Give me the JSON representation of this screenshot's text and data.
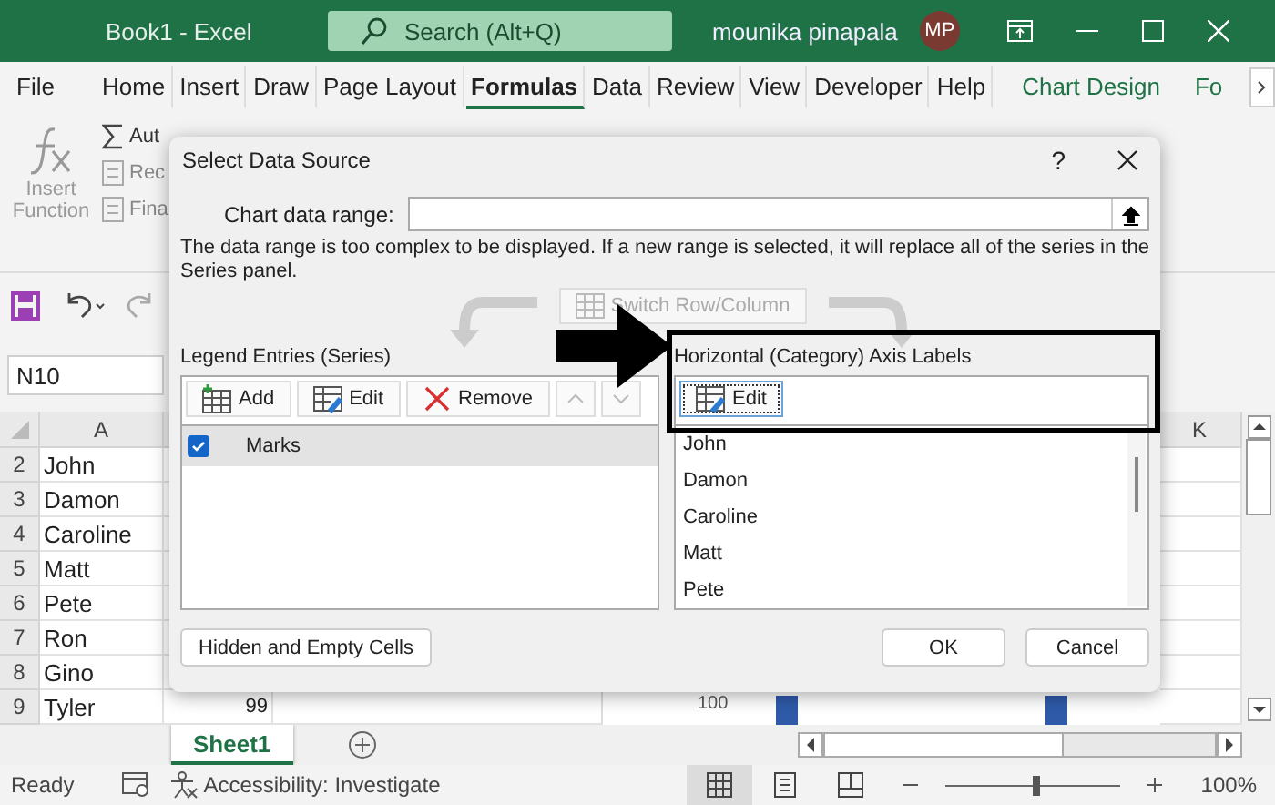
{
  "window": {
    "title": "Book1 - Excel",
    "search_placeholder": "Search (Alt+Q)",
    "user": "mounika pinapala",
    "avatar": "MP"
  },
  "ribbon_tabs": [
    {
      "label": "File",
      "selected": false,
      "kind": "plain"
    },
    {
      "label": "Home",
      "selected": false,
      "kind": "plain"
    },
    {
      "label": "Insert",
      "selected": false,
      "kind": "plain"
    },
    {
      "label": "Draw",
      "selected": false,
      "kind": "plain"
    },
    {
      "label": "Page Layout",
      "selected": false,
      "kind": "plain"
    },
    {
      "label": "Formulas",
      "selected": true,
      "kind": "plain"
    },
    {
      "label": "Data",
      "selected": false,
      "kind": "plain"
    },
    {
      "label": "Review",
      "selected": false,
      "kind": "plain"
    },
    {
      "label": "View",
      "selected": false,
      "kind": "plain"
    },
    {
      "label": "Developer",
      "selected": false,
      "kind": "plain"
    },
    {
      "label": "Help",
      "selected": false,
      "kind": "plain"
    },
    {
      "label": "Chart Design",
      "selected": false,
      "kind": "context"
    },
    {
      "label": "Fo",
      "selected": false,
      "kind": "context"
    }
  ],
  "ribbon": {
    "insert_function": "Insert Function",
    "commands": [
      "Aut",
      "Rec",
      "Fina"
    ]
  },
  "name_box": "N10",
  "grid": {
    "column_headers": [
      "A",
      "K"
    ],
    "rows": [
      {
        "number": "2",
        "name": "John"
      },
      {
        "number": "3",
        "name": "Damon"
      },
      {
        "number": "4",
        "name": "Caroline"
      },
      {
        "number": "5",
        "name": "Matt"
      },
      {
        "number": "6",
        "name": "Pete"
      },
      {
        "number": "7",
        "name": "Ron"
      },
      {
        "number": "8",
        "name": "Gino"
      },
      {
        "number": "9",
        "name": "Tyler",
        "value": "99"
      }
    ]
  },
  "chart_axis_label": "100",
  "sheet_tabs": [
    {
      "label": "Sheet1",
      "selected": true
    }
  ],
  "status_bar": {
    "ready": "Ready",
    "accessibility": "Accessibility: Investigate",
    "zoom": "100%",
    "zoom_slider": {
      "level": 0.5
    }
  },
  "dialog": {
    "title": "Select Data Source",
    "help": "?",
    "chart_data_range": {
      "label": "Chart data range:"
    },
    "message": "The data range is too complex to be displayed. If a new range is selected, it will replace all of the series in the Series panel.",
    "switch_button": {
      "label": "Switch Row/Column",
      "disabled": true
    },
    "legend_entries": {
      "label": "Legend Entries (Series)",
      "buttons": [
        {
          "label": "Add",
          "kind": "add"
        },
        {
          "label": "Edit",
          "kind": "edit"
        },
        {
          "label": "Remove",
          "kind": "remove"
        }
      ],
      "move_buttons": [
        {
          "kind": "up",
          "disabled": true
        },
        {
          "kind": "down",
          "disabled": true
        }
      ],
      "items": [
        {
          "label": "Marks",
          "checked": true,
          "selected": true
        }
      ]
    },
    "axis_labels": {
      "label": "Horizontal (Category) Axis Labels",
      "edit_button": {
        "label": "Edit",
        "focused": true
      },
      "items": [
        "John",
        "Damon",
        "Caroline",
        "Matt",
        "Pete"
      ]
    },
    "footer_buttons": [
      {
        "label": "Hidden and Empty Cells",
        "kind": "left"
      },
      {
        "label": "OK",
        "kind": "right"
      },
      {
        "label": "Cancel",
        "kind": "right"
      }
    ]
  }
}
